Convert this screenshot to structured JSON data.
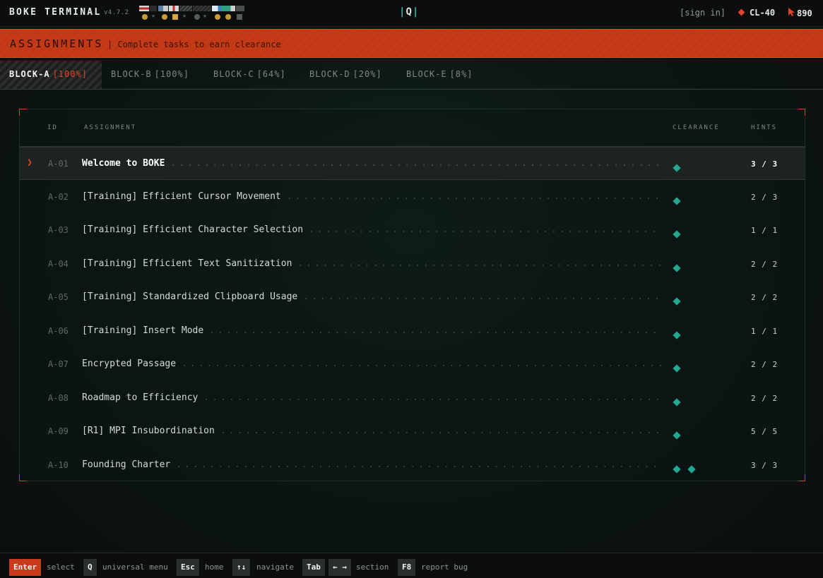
{
  "header": {
    "title": "BOKE TERMINAL",
    "version": "v4.7.2",
    "logo": "[Q]",
    "signin": "[sign in]",
    "clearance": "CL-40",
    "points": "890",
    "colors": {
      "accent": "#e0442a",
      "teal": "#21a892"
    }
  },
  "banner": {
    "title": "ASSIGNMENTS",
    "subtitle": "| Complete tasks to earn clearance"
  },
  "tabs": [
    {
      "label": "BLOCK-A",
      "pct": "[100%]",
      "active": true
    },
    {
      "label": "BLOCK-B",
      "pct": "[100%]"
    },
    {
      "label": "BLOCK-C",
      "pct": "[64%]"
    },
    {
      "label": "BLOCK-D",
      "pct": "[20%]"
    },
    {
      "label": "BLOCK-E",
      "pct": "[8%]"
    }
  ],
  "table": {
    "headers": {
      "id": "ID",
      "assignment": "ASSIGNMENT",
      "clearance": "CLEARANCE",
      "hints": "HINTS"
    },
    "rows": [
      {
        "id": "A-01",
        "name": "Welcome to BOKE",
        "clearance": 1,
        "hints": "3 / 3",
        "selected": true
      },
      {
        "id": "A-02",
        "name": "[Training] Efficient Cursor Movement",
        "clearance": 1,
        "hints": "2 / 3"
      },
      {
        "id": "A-03",
        "name": "[Training] Efficient Character Selection",
        "clearance": 1,
        "hints": "1 / 1"
      },
      {
        "id": "A-04",
        "name": "[Training] Efficient Text Sanitization",
        "clearance": 1,
        "hints": "2 / 2"
      },
      {
        "id": "A-05",
        "name": "[Training] Standardized Clipboard Usage",
        "clearance": 1,
        "hints": "2 / 2"
      },
      {
        "id": "A-06",
        "name": "[Training] Insert Mode",
        "clearance": 1,
        "hints": "1 / 1"
      },
      {
        "id": "A-07",
        "name": "Encrypted Passage",
        "clearance": 1,
        "hints": "2 / 2"
      },
      {
        "id": "A-08",
        "name": "Roadmap to Efficiency",
        "clearance": 1,
        "hints": "2 / 2"
      },
      {
        "id": "A-09",
        "name": "[R1] MPI Insubordination",
        "clearance": 1,
        "hints": "5 / 5"
      },
      {
        "id": "A-10",
        "name": "Founding Charter",
        "clearance": 2,
        "hints": "3 / 3"
      }
    ]
  },
  "footer": {
    "enter_key": "Enter",
    "enter_label": "select",
    "q_key": "Q",
    "q_label": "universal menu",
    "esc_key": "Esc",
    "esc_label": "home",
    "nav_key": "↑↓",
    "nav_label": "navigate",
    "tab_key": "Tab",
    "arrows_key": "← →",
    "section_label": "section",
    "f8_key": "F8",
    "f8_label": "report bug"
  }
}
